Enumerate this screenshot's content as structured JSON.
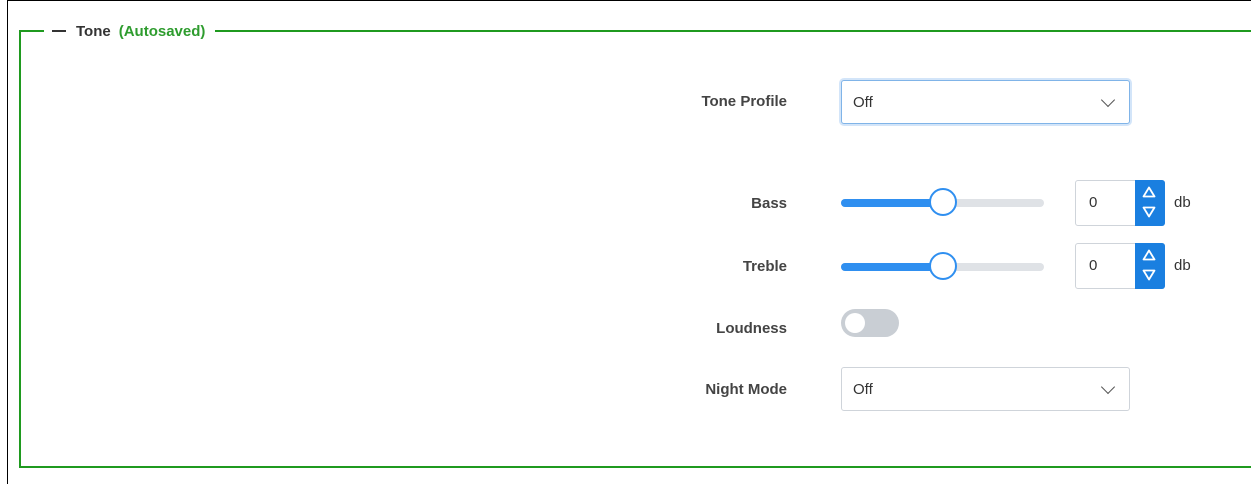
{
  "section": {
    "title": "Tone",
    "status": "(Autosaved)"
  },
  "tone_profile": {
    "label": "Tone Profile",
    "value": "Off"
  },
  "bass": {
    "label": "Bass",
    "value": "0",
    "unit": "db",
    "slider_level": 0.5
  },
  "treble": {
    "label": "Treble",
    "value": "0",
    "unit": "db",
    "slider_level": 0.5
  },
  "loudness": {
    "label": "Loudness",
    "enabled": false
  },
  "night_mode": {
    "label": "Night Mode",
    "value": "Off"
  },
  "colors": {
    "accent": "#2f8ff0",
    "section_border": "#1f9a1f",
    "autosaved_text": "#2e9c2e",
    "toggle_off": "#c9ced4"
  },
  "icons": {
    "dropdown": "chevron-down-icon",
    "increment": "triangle-up-icon",
    "decrement": "triangle-down-icon",
    "collapse": "minus-icon"
  }
}
